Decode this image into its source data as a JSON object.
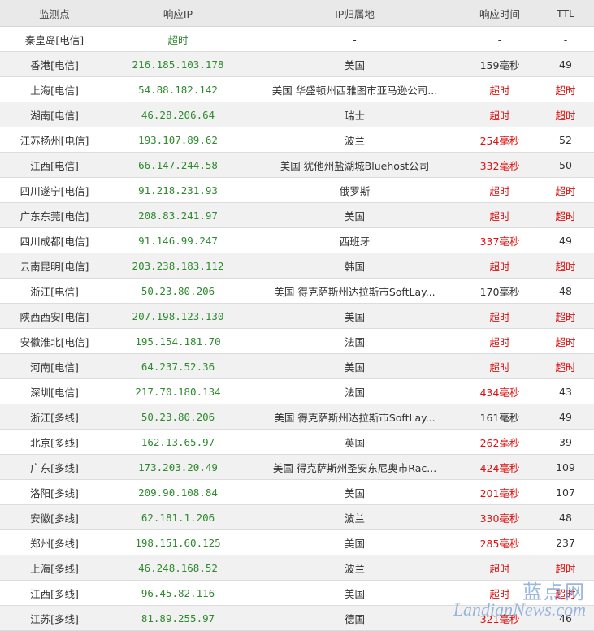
{
  "headers": [
    "监测点",
    "响应IP",
    "IP归属地",
    "响应时间",
    "TTL"
  ],
  "rows": [
    {
      "point": "秦皇岛[电信]",
      "ip": "超时",
      "loc": "-",
      "time": "-",
      "ttl": "-"
    },
    {
      "point": "香港[电信]",
      "ip": "216.185.103.178",
      "loc": "美国",
      "time": "159毫秒",
      "ttl": "49"
    },
    {
      "point": "上海[电信]",
      "ip": "54.88.182.142",
      "loc": "美国 华盛顿州西雅图市亚马逊公司...",
      "time": "超时",
      "ttl": "超时"
    },
    {
      "point": "湖南[电信]",
      "ip": "46.28.206.64",
      "loc": "瑞士",
      "time": "超时",
      "ttl": "超时"
    },
    {
      "point": "江苏扬州[电信]",
      "ip": "193.107.89.62",
      "loc": "波兰",
      "time": "254毫秒",
      "ttl": "52"
    },
    {
      "point": "江西[电信]",
      "ip": "66.147.244.58",
      "loc": "美国 犹他州盐湖城Bluehost公司",
      "time": "332毫秒",
      "ttl": "50"
    },
    {
      "point": "四川遂宁[电信]",
      "ip": "91.218.231.93",
      "loc": "俄罗斯",
      "time": "超时",
      "ttl": "超时"
    },
    {
      "point": "广东东莞[电信]",
      "ip": "208.83.241.97",
      "loc": "美国",
      "time": "超时",
      "ttl": "超时"
    },
    {
      "point": "四川成都[电信]",
      "ip": "91.146.99.247",
      "loc": "西班牙",
      "time": "337毫秒",
      "ttl": "49"
    },
    {
      "point": "云南昆明[电信]",
      "ip": "203.238.183.112",
      "loc": "韩国",
      "time": "超时",
      "ttl": "超时"
    },
    {
      "point": "浙江[电信]",
      "ip": "50.23.80.206",
      "loc": "美国 得克萨斯州达拉斯市SoftLay...",
      "time": "170毫秒",
      "ttl": "48"
    },
    {
      "point": "陕西西安[电信]",
      "ip": "207.198.123.130",
      "loc": "美国",
      "time": "超时",
      "ttl": "超时"
    },
    {
      "point": "安徽淮北[电信]",
      "ip": "195.154.181.70",
      "loc": "法国",
      "time": "超时",
      "ttl": "超时"
    },
    {
      "point": "河南[电信]",
      "ip": "64.237.52.36",
      "loc": "美国",
      "time": "超时",
      "ttl": "超时"
    },
    {
      "point": "深圳[电信]",
      "ip": "217.70.180.134",
      "loc": "法国",
      "time": "434毫秒",
      "ttl": "43"
    },
    {
      "point": "浙江[多线]",
      "ip": "50.23.80.206",
      "loc": "美国 得克萨斯州达拉斯市SoftLay...",
      "time": "161毫秒",
      "ttl": "49"
    },
    {
      "point": "北京[多线]",
      "ip": "162.13.65.97",
      "loc": "英国",
      "time": "262毫秒",
      "ttl": "39"
    },
    {
      "point": "广东[多线]",
      "ip": "173.203.20.49",
      "loc": "美国 得克萨斯州圣安东尼奥市Rac...",
      "time": "424毫秒",
      "ttl": "109"
    },
    {
      "point": "洛阳[多线]",
      "ip": "209.90.108.84",
      "loc": "美国",
      "time": "201毫秒",
      "ttl": "107"
    },
    {
      "point": "安徽[多线]",
      "ip": "62.181.1.206",
      "loc": "波兰",
      "time": "330毫秒",
      "ttl": "48"
    },
    {
      "point": "郑州[多线]",
      "ip": "198.151.60.125",
      "loc": "美国",
      "time": "285毫秒",
      "ttl": "237"
    },
    {
      "point": "上海[多线]",
      "ip": "46.248.168.52",
      "loc": "波兰",
      "time": "超时",
      "ttl": "超时"
    },
    {
      "point": "江西[多线]",
      "ip": "96.45.82.116",
      "loc": "美国",
      "time": "超时",
      "ttl": "超时"
    },
    {
      "point": "江苏[多线]",
      "ip": "81.89.255.97",
      "loc": "德国",
      "time": "321毫秒",
      "ttl": "46"
    }
  ],
  "watermark": {
    "cn": "蓝点网",
    "en": "LandianNews.com"
  },
  "colors": {
    "ip": "#2f8a2f",
    "timeout": "#e01010",
    "header_bg": "#e9e9e9",
    "stripe_bg": "#f1f1f1"
  }
}
